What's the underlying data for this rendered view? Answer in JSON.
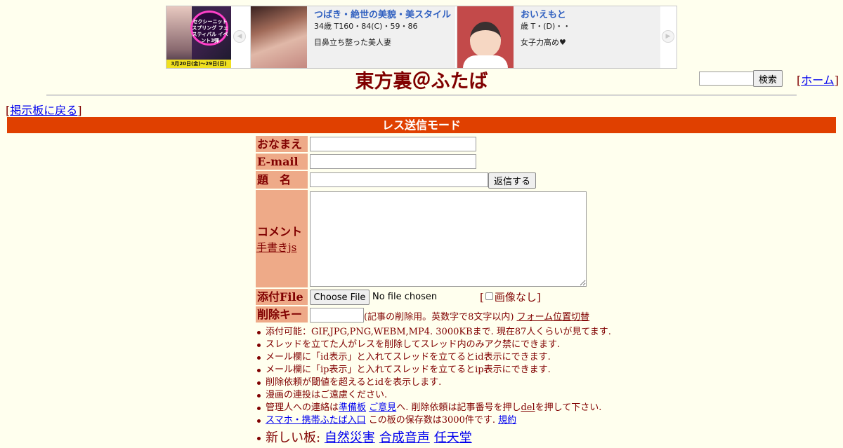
{
  "ad": {
    "promo": {
      "text": "セクシーニット スプリング フェスティバル イベント3弾",
      "date": "3月20日(金)〜29日(日)"
    },
    "prev_arrow": "◀",
    "next_arrow": "▶",
    "cards": [
      {
        "name": "つばき・絶世の美貌・美スタイル",
        "spec": "34歳 T160・84(C)・59・86",
        "catch": "目鼻立ち整った美人妻"
      },
      {
        "name": "おいえもと",
        "spec": "歳 T・(D)・・",
        "catch": "女子力高め♥"
      }
    ]
  },
  "header": {
    "title": "東方裏＠ふたば",
    "search_button": "検索",
    "home_link": "ホーム",
    "back_link": "掲示板に戻る"
  },
  "mode_bar": "レス送信モード",
  "form": {
    "name_label": "おなまえ",
    "email_label": "E-mail",
    "subject_label": "題　名",
    "reply_button": "返信する",
    "comment_label": "コメント",
    "oekaki_link": "手書きjs",
    "file_label": "添付File",
    "file_button": "Choose File",
    "file_status": "No file chosen",
    "noimage_label": "画像なし",
    "delkey_label": "削除キー",
    "delkey_note": "(記事の削除用。英数字で8文字以内)",
    "position_toggle": "フォーム位置切替"
  },
  "notes": {
    "n1": "添付可能：GIF,JPG,PNG,WEBM,MP4. 3000KBまで. 現在87人くらいが見てます.",
    "n2": "スレッドを立てた人がレスを削除してスレッド内のみアク禁にできます.",
    "n3": "メール欄に「id表示」と入れてスレッドを立てるとid表示にできます.",
    "n4": "メール欄に「ip表示」と入れてスレッドを立てるとip表示にできます.",
    "n5": "削除依頼が閾値を超えるとidを表示します.",
    "n6": "漫画の連投はご遠慮ください.",
    "n7_pre": "管理人への連絡は",
    "n7_link1": "準備板",
    "n7_link2": "ご意見",
    "n7_mid": "へ. 削除依頼は記事番号を押し",
    "n7_del": "del",
    "n7_post": "を押して下さい.",
    "n8_link": "スマホ・携帯ふたば入口",
    "n8_text": "この板の保存数は3000件です.",
    "n8_rules": "規約",
    "newboards_label": "新しい板:",
    "newboards": [
      "自然災害",
      "合成音声",
      "任天堂"
    ]
  }
}
